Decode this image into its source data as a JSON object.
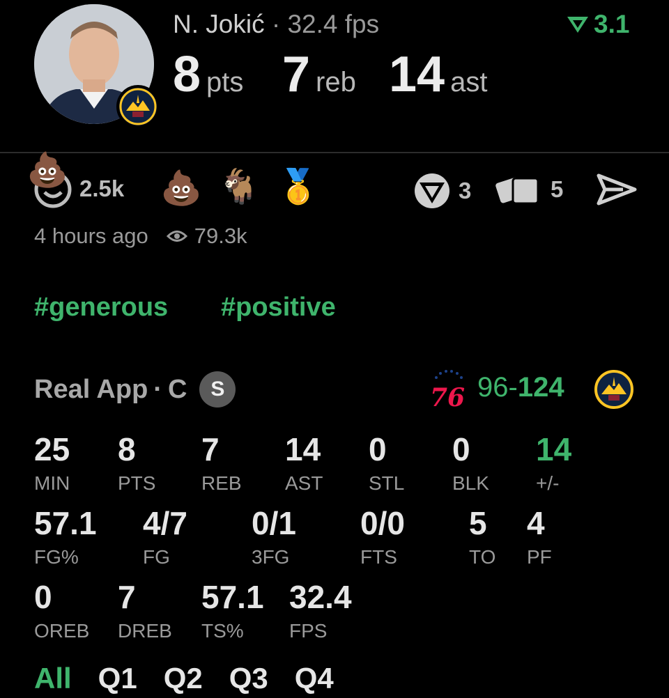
{
  "header": {
    "player_name": "N. Jokić",
    "separator": "·",
    "fps": "32.4 fps",
    "pts": "8",
    "pts_unit": "pts",
    "reb": "7",
    "reb_unit": "reb",
    "ast": "14",
    "ast_unit": "ast",
    "rating": "3.1"
  },
  "reactions": {
    "emoji_face_count": "2.5k",
    "icons": [
      "poop-with-smile-icon",
      "poop-icon",
      "goat-icon",
      "medal-icon"
    ],
    "predictions_count": "3",
    "cards_count": "5"
  },
  "meta": {
    "time_ago": "4 hours ago",
    "views": "79.3k"
  },
  "tags": [
    "#generous",
    "#positive"
  ],
  "game": {
    "source": "Real App",
    "position": "C",
    "badge": "S",
    "away_score": "96",
    "dash": "-",
    "home_score": "124",
    "away_team": "76"
  },
  "stats": {
    "row1": [
      {
        "value": "25",
        "label": "MIN"
      },
      {
        "value": "8",
        "label": "PTS"
      },
      {
        "value": "7",
        "label": "REB"
      },
      {
        "value": "14",
        "label": "AST"
      },
      {
        "value": "0",
        "label": "STL"
      },
      {
        "value": "0",
        "label": "BLK"
      },
      {
        "value": "14",
        "label": "+/-"
      }
    ],
    "row2": [
      {
        "value": "57.1",
        "label": "FG%"
      },
      {
        "value": "4/7",
        "label": "FG"
      },
      {
        "value": "0/1",
        "label": "3FG"
      },
      {
        "value": "0/0",
        "label": "FTS"
      },
      {
        "value": "5",
        "label": "TO"
      },
      {
        "value": "4",
        "label": "PF"
      }
    ],
    "row3": [
      {
        "value": "0",
        "label": "OREB"
      },
      {
        "value": "7",
        "label": "DREB"
      },
      {
        "value": "57.1",
        "label": "TS%"
      },
      {
        "value": "32.4",
        "label": "FPS"
      }
    ]
  },
  "quarters": [
    "All",
    "Q1",
    "Q2",
    "Q3",
    "Q4"
  ],
  "colors": {
    "accent": "#3fb46c",
    "background": "#000000"
  }
}
